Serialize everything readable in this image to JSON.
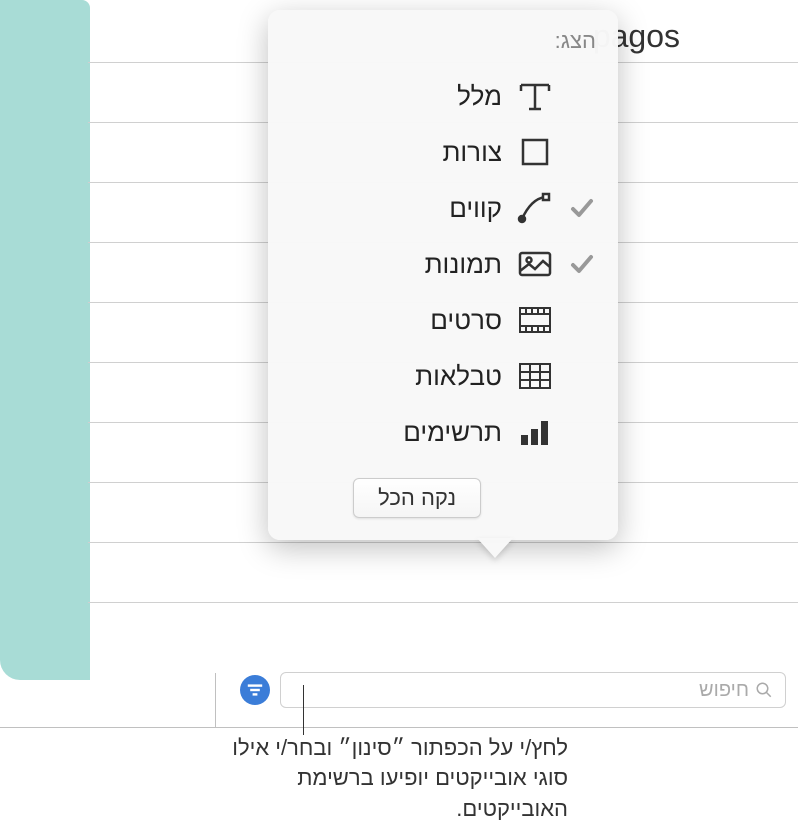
{
  "background": {
    "text_fragment": "pagos"
  },
  "search": {
    "placeholder": "חיפוש"
  },
  "popover": {
    "title": "הצג:",
    "items": [
      {
        "label": "מלל",
        "icon": "text",
        "checked": false
      },
      {
        "label": "צורות",
        "icon": "shape",
        "checked": false
      },
      {
        "label": "קווים",
        "icon": "line",
        "checked": true
      },
      {
        "label": "תמונות",
        "icon": "image",
        "checked": true
      },
      {
        "label": "סרטים",
        "icon": "movie",
        "checked": false
      },
      {
        "label": "טבלאות",
        "icon": "table",
        "checked": false
      },
      {
        "label": "תרשימים",
        "icon": "chart",
        "checked": false
      }
    ],
    "clear_label": "נקה הכל"
  },
  "annotation": {
    "text": "לחץ/י על הכפתור ״סינון״ ובחר/י אילו סוגי אובייקטים יופיעו ברשימת האובייקטים."
  },
  "colors": {
    "teal": "#a8dcd6",
    "filter_button": "#3b7dd8",
    "check": "#999"
  }
}
